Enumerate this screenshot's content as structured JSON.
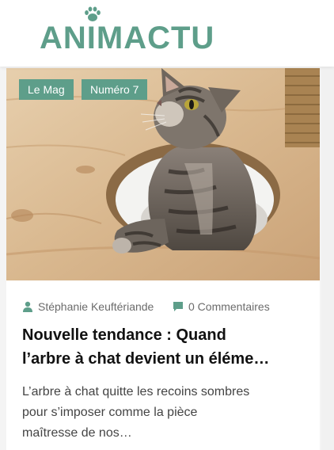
{
  "header": {
    "logo_text": "ANIMACTU",
    "logo_icon": "paw-icon"
  },
  "colors": {
    "brand": "#5e9e8a",
    "title": "#111111",
    "meta": "#6b6b6b",
    "excerpt": "#444444"
  },
  "article": {
    "tags": [
      "Le Mag",
      "Numéro 7"
    ],
    "author": "Stéphanie Keuftériande",
    "author_icon": "user-icon",
    "comments": "0 Commentaires",
    "comments_icon": "comment-icon",
    "title_line1": "Nouvelle tendance : Quand",
    "title_line2": "l’arbre à chat devient un éléme…",
    "excerpt_line1": "L’arbre à chat quitte les recoins sombres",
    "excerpt_line2": "pour s’imposer comme la pièce",
    "excerpt_line3": "maîtresse de nos…",
    "image": "tabby kitten in a cat tree hole"
  }
}
